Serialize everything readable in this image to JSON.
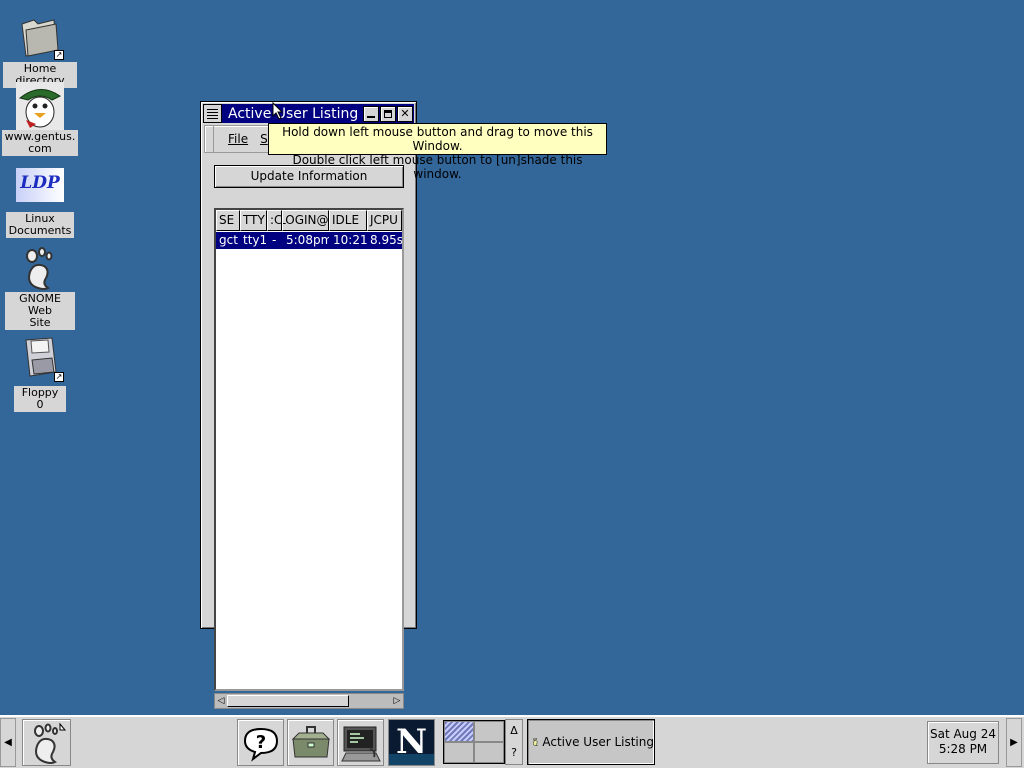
{
  "desktop": {
    "background": "#336699",
    "icons": [
      {
        "label": "Home directory",
        "icon": "folder-icon"
      },
      {
        "label": "www.gentus.\ncom",
        "icon": "gentus-logo-icon"
      },
      {
        "label": "Linux\nDocuments",
        "icon": "ldp-logo-icon",
        "logo_text": "LDP"
      },
      {
        "label": "GNOME Web\nSite",
        "icon": "gnome-foot-icon"
      },
      {
        "label": "Floppy 0",
        "icon": "floppy-icon"
      }
    ]
  },
  "window": {
    "title": "Active User Listing",
    "menu": {
      "file": "File",
      "second_initial": "S"
    },
    "update_button": "Update Information",
    "columns": [
      "SE",
      "TTY",
      ":C",
      "LOGIN@",
      "IDLE",
      "JCPU"
    ],
    "rows": [
      {
        "user": "gct",
        "tty": "tty1",
        "from": "-",
        "login": "5:08pm",
        "idle": "10:21",
        "jcpu": "8.95s"
      }
    ]
  },
  "tooltip": {
    "line1": "Hold down left mouse button and drag to move this Window.",
    "line2": "Double click left mouse button to [un]shade this window."
  },
  "panel": {
    "launchers": [
      "help-icon",
      "toolbox-icon",
      "terminal-icon",
      "netscape-icon"
    ],
    "netscape_letter": "N",
    "pager_side": {
      "up": "Δ",
      "help": "?"
    },
    "task": "Active User Listing",
    "clock": {
      "date": "Sat Aug 24",
      "time": "5:28 PM"
    }
  }
}
